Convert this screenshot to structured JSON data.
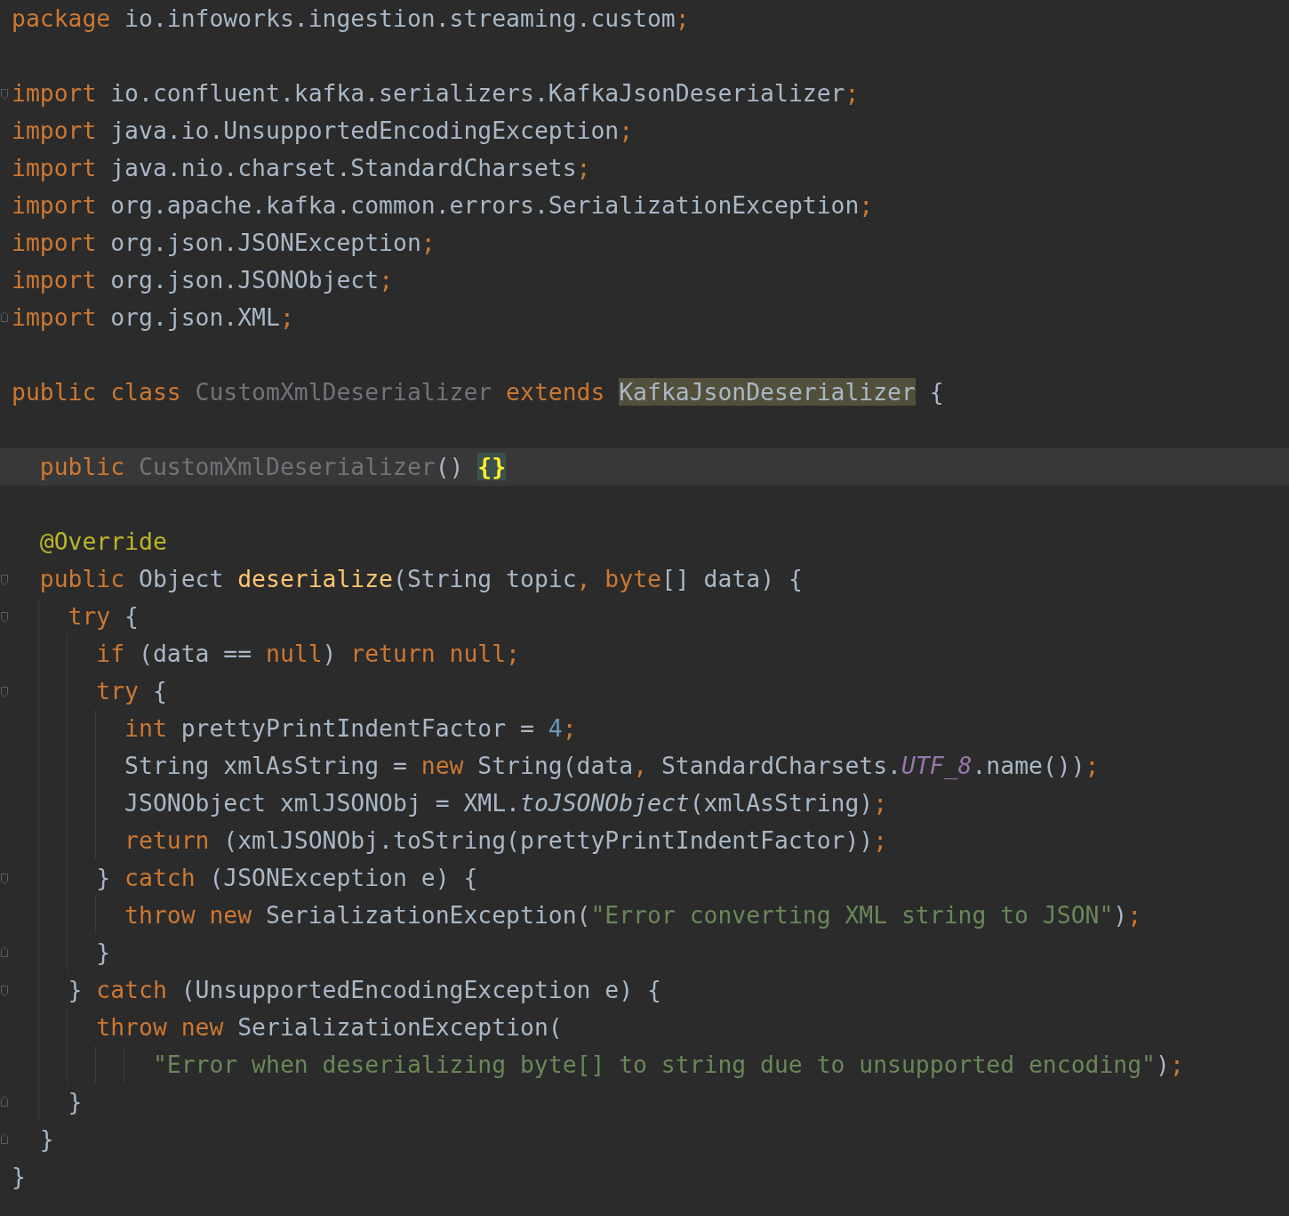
{
  "editor": {
    "lines": [
      {
        "kind": "code",
        "current": false,
        "fold_start": false,
        "fold_end": false,
        "tokens": [
          {
            "text": "package ",
            "kind": "keyword"
          },
          {
            "text": "io.infoworks.ingestion.streaming.custom",
            "kind": "plain"
          },
          {
            "text": ";",
            "kind": "keyword"
          }
        ]
      },
      {
        "kind": "blank",
        "current": false,
        "fold_start": false,
        "fold_end": false
      },
      {
        "kind": "code",
        "current": false,
        "fold_start": true,
        "fold_end": false,
        "tokens": [
          {
            "text": "import ",
            "kind": "keyword"
          },
          {
            "text": "io.confluent.kafka.serializers.KafkaJsonDeserializer",
            "kind": "plain"
          },
          {
            "text": ";",
            "kind": "keyword"
          }
        ]
      },
      {
        "kind": "code",
        "current": false,
        "fold_start": false,
        "fold_end": false,
        "tokens": [
          {
            "text": "import ",
            "kind": "keyword"
          },
          {
            "text": "java.io.UnsupportedEncodingException",
            "kind": "plain"
          },
          {
            "text": ";",
            "kind": "keyword"
          }
        ]
      },
      {
        "kind": "code",
        "current": false,
        "fold_start": false,
        "fold_end": false,
        "tokens": [
          {
            "text": "import ",
            "kind": "keyword"
          },
          {
            "text": "java.nio.charset.StandardCharsets",
            "kind": "plain"
          },
          {
            "text": ";",
            "kind": "keyword"
          }
        ]
      },
      {
        "kind": "code",
        "current": false,
        "fold_start": false,
        "fold_end": false,
        "tokens": [
          {
            "text": "import ",
            "kind": "keyword"
          },
          {
            "text": "org.apache.kafka.common.errors.SerializationException",
            "kind": "plain"
          },
          {
            "text": ";",
            "kind": "keyword"
          }
        ]
      },
      {
        "kind": "code",
        "current": false,
        "fold_start": false,
        "fold_end": false,
        "tokens": [
          {
            "text": "import ",
            "kind": "keyword"
          },
          {
            "text": "org.json.JSONException",
            "kind": "plain"
          },
          {
            "text": ";",
            "kind": "keyword"
          }
        ]
      },
      {
        "kind": "code",
        "current": false,
        "fold_start": false,
        "fold_end": false,
        "tokens": [
          {
            "text": "import ",
            "kind": "keyword"
          },
          {
            "text": "org.json.JSONObject",
            "kind": "plain"
          },
          {
            "text": ";",
            "kind": "keyword"
          }
        ]
      },
      {
        "kind": "code",
        "current": false,
        "fold_start": false,
        "fold_end": true,
        "tokens": [
          {
            "text": "import ",
            "kind": "keyword"
          },
          {
            "text": "org.json.XML",
            "kind": "plain"
          },
          {
            "text": ";",
            "kind": "keyword"
          }
        ]
      },
      {
        "kind": "blank",
        "current": false,
        "fold_start": false,
        "fold_end": false
      },
      {
        "kind": "code",
        "current": false,
        "fold_start": false,
        "fold_end": false,
        "tokens": [
          {
            "text": "public class ",
            "kind": "keyword"
          },
          {
            "text": "CustomXmlDeserializer",
            "kind": "unused"
          },
          {
            "text": " extends ",
            "kind": "keyword"
          },
          {
            "text": "KafkaJsonDeserializer",
            "kind": "highlight"
          },
          {
            "text": " {",
            "kind": "plain"
          }
        ]
      },
      {
        "kind": "blank",
        "current": false,
        "fold_start": false,
        "fold_end": false
      },
      {
        "kind": "code",
        "current": true,
        "fold_start": false,
        "fold_end": false,
        "tokens": [
          {
            "text": "  public ",
            "kind": "keyword"
          },
          {
            "text": "CustomXmlDeserializer",
            "kind": "unused"
          },
          {
            "text": "() ",
            "kind": "plain"
          },
          {
            "text": "{}",
            "kind": "brace-match"
          }
        ]
      },
      {
        "kind": "blank",
        "current": false,
        "fold_start": false,
        "fold_end": false
      },
      {
        "kind": "code",
        "current": false,
        "fold_start": false,
        "fold_end": false,
        "tokens": [
          {
            "text": "  @Override",
            "kind": "annotation"
          }
        ]
      },
      {
        "kind": "code",
        "current": false,
        "fold_start": true,
        "fold_end": false,
        "tokens": [
          {
            "text": "  public ",
            "kind": "keyword"
          },
          {
            "text": "Object ",
            "kind": "plain"
          },
          {
            "text": "deserialize",
            "kind": "method-decl"
          },
          {
            "text": "(String topic",
            "kind": "plain"
          },
          {
            "text": ", ",
            "kind": "keyword"
          },
          {
            "text": "byte",
            "kind": "keyword"
          },
          {
            "text": "[] data) {",
            "kind": "plain"
          }
        ]
      },
      {
        "kind": "code",
        "current": false,
        "fold_start": true,
        "fold_end": false,
        "tokens": [
          {
            "text": "    try ",
            "kind": "keyword"
          },
          {
            "text": "{",
            "kind": "plain"
          }
        ]
      },
      {
        "kind": "code",
        "current": false,
        "fold_start": false,
        "fold_end": false,
        "tokens": [
          {
            "text": "      if ",
            "kind": "keyword"
          },
          {
            "text": "(data == ",
            "kind": "plain"
          },
          {
            "text": "null",
            "kind": "keyword"
          },
          {
            "text": ") ",
            "kind": "plain"
          },
          {
            "text": "return null;",
            "kind": "keyword"
          }
        ]
      },
      {
        "kind": "code",
        "current": false,
        "fold_start": true,
        "fold_end": false,
        "tokens": [
          {
            "text": "      try ",
            "kind": "keyword"
          },
          {
            "text": "{",
            "kind": "plain"
          }
        ]
      },
      {
        "kind": "code",
        "current": false,
        "fold_start": false,
        "fold_end": false,
        "tokens": [
          {
            "text": "        int ",
            "kind": "keyword"
          },
          {
            "text": "prettyPrintIndentFactor = ",
            "kind": "plain"
          },
          {
            "text": "4",
            "kind": "number"
          },
          {
            "text": ";",
            "kind": "keyword"
          }
        ]
      },
      {
        "kind": "code",
        "current": false,
        "fold_start": false,
        "fold_end": false,
        "tokens": [
          {
            "text": "        String xmlAsString = ",
            "kind": "plain"
          },
          {
            "text": "new ",
            "kind": "keyword"
          },
          {
            "text": "String(data",
            "kind": "plain"
          },
          {
            "text": ", ",
            "kind": "keyword"
          },
          {
            "text": "StandardCharsets.",
            "kind": "plain"
          },
          {
            "text": "UTF_8",
            "kind": "constant"
          },
          {
            "text": ".name())",
            "kind": "plain"
          },
          {
            "text": ";",
            "kind": "keyword"
          }
        ]
      },
      {
        "kind": "code",
        "current": false,
        "fold_start": false,
        "fold_end": false,
        "tokens": [
          {
            "text": "        JSONObject xmlJSONObj = XML.",
            "kind": "plain"
          },
          {
            "text": "toJSONObject",
            "kind": "static-call"
          },
          {
            "text": "(xmlAsString)",
            "kind": "plain"
          },
          {
            "text": ";",
            "kind": "keyword"
          }
        ]
      },
      {
        "kind": "code",
        "current": false,
        "fold_start": false,
        "fold_end": false,
        "tokens": [
          {
            "text": "        return ",
            "kind": "keyword"
          },
          {
            "text": "(xmlJSONObj.toString(prettyPrintIndentFactor))",
            "kind": "plain"
          },
          {
            "text": ";",
            "kind": "keyword"
          }
        ]
      },
      {
        "kind": "code",
        "current": false,
        "fold_start": true,
        "fold_end": false,
        "tokens": [
          {
            "text": "      } ",
            "kind": "plain"
          },
          {
            "text": "catch ",
            "kind": "keyword"
          },
          {
            "text": "(JSONException e) {",
            "kind": "plain"
          }
        ]
      },
      {
        "kind": "code",
        "current": false,
        "fold_start": false,
        "fold_end": false,
        "tokens": [
          {
            "text": "        throw new ",
            "kind": "keyword"
          },
          {
            "text": "SerializationException(",
            "kind": "plain"
          },
          {
            "text": "\"Error converting XML string to JSON\"",
            "kind": "string"
          },
          {
            "text": ")",
            "kind": "plain"
          },
          {
            "text": ";",
            "kind": "keyword"
          }
        ]
      },
      {
        "kind": "code",
        "current": false,
        "fold_start": false,
        "fold_end": true,
        "tokens": [
          {
            "text": "      }",
            "kind": "plain"
          }
        ]
      },
      {
        "kind": "code",
        "current": false,
        "fold_start": true,
        "fold_end": false,
        "tokens": [
          {
            "text": "    } ",
            "kind": "plain"
          },
          {
            "text": "catch ",
            "kind": "keyword"
          },
          {
            "text": "(UnsupportedEncodingException e) {",
            "kind": "plain"
          }
        ]
      },
      {
        "kind": "code",
        "current": false,
        "fold_start": false,
        "fold_end": false,
        "tokens": [
          {
            "text": "      throw new ",
            "kind": "keyword"
          },
          {
            "text": "SerializationException(",
            "kind": "plain"
          }
        ]
      },
      {
        "kind": "code",
        "current": false,
        "fold_start": false,
        "fold_end": false,
        "tokens": [
          {
            "text": "          \"Error when deserializing byte[] to string due to unsupported encoding\"",
            "kind": "string"
          },
          {
            "text": ")",
            "kind": "plain"
          },
          {
            "text": ";",
            "kind": "keyword"
          }
        ]
      },
      {
        "kind": "code",
        "current": false,
        "fold_start": false,
        "fold_end": true,
        "tokens": [
          {
            "text": "    }",
            "kind": "plain"
          }
        ]
      },
      {
        "kind": "code",
        "current": false,
        "fold_start": false,
        "fold_end": true,
        "tokens": [
          {
            "text": "  }",
            "kind": "plain"
          }
        ]
      },
      {
        "kind": "code",
        "current": false,
        "fold_start": false,
        "fold_end": false,
        "tokens": [
          {
            "text": "}",
            "kind": "plain"
          }
        ]
      }
    ]
  }
}
